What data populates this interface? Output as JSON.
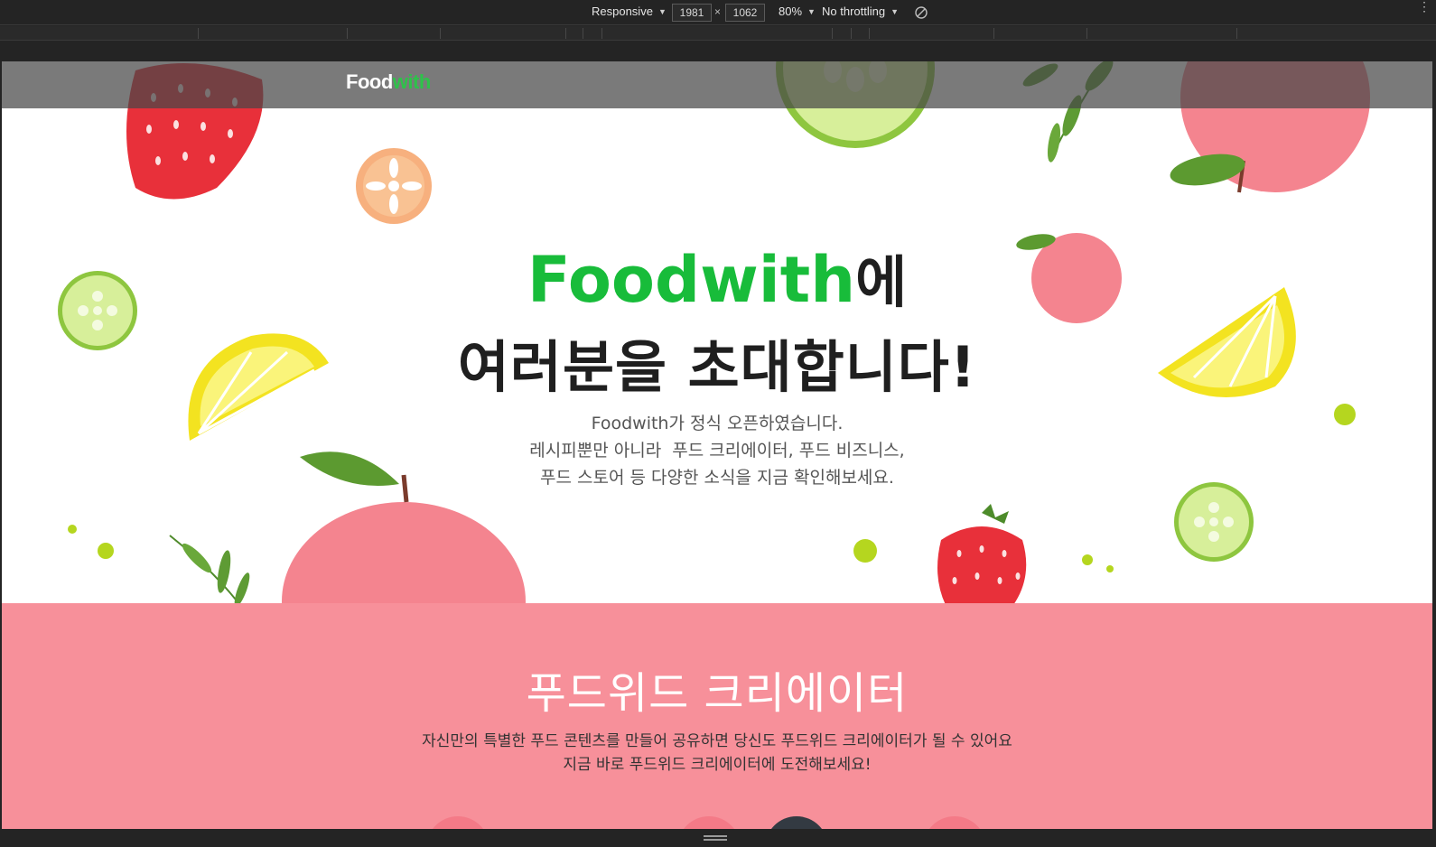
{
  "devtools": {
    "device": "Responsive",
    "width": "1981",
    "height": "1062",
    "zoom": "80%",
    "throttling": "No throttling",
    "times": "×"
  },
  "header": {
    "logo_part1": "Food",
    "logo_part2": "with"
  },
  "hero": {
    "title_brand": "Foodwith",
    "title_suffix": "에",
    "title_line2": "여러분을 초대합니다!",
    "desc_line1": "Foodwith가 정식 오픈하였습니다.",
    "desc_line2": "레시피뿐만 아니라  푸드 크리에이터, 푸드 비즈니스,",
    "desc_line3": "푸드 스토어 등 다양한 소식을 지금 확인해보세요."
  },
  "creator": {
    "title": "푸드위드 크리에이터",
    "desc_line1": "자신만의 특별한 푸드 콘텐츠를 만들어 공유하면 당신도 푸드위드 크리에이터가 될 수 있어요",
    "desc_line2": "지금 바로 푸드위드 크리에이터에 도전해보세요!"
  },
  "colors": {
    "brand_green": "#18bc3a",
    "creator_bg": "#f7909a",
    "header_overlay": "#464646"
  }
}
